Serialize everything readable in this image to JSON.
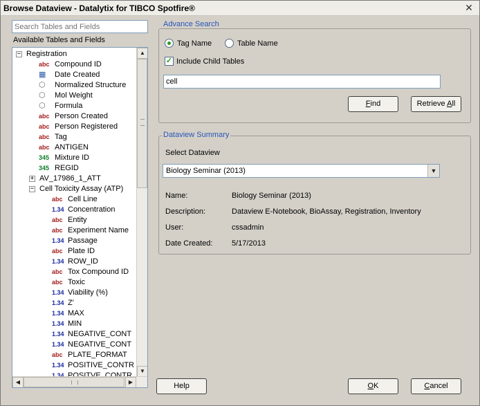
{
  "window": {
    "title": "Browse Dataview - Datalytix for TIBCO Spotfire®",
    "close_glyph": "✕"
  },
  "search": {
    "placeholder": "Search Tables and Fields",
    "value": ""
  },
  "available_label": "Available Tables and Fields",
  "tree": [
    {
      "level": 0,
      "expander": "−",
      "icon": "",
      "label": "Registration"
    },
    {
      "level": 1,
      "expander": "",
      "icon": "abc",
      "label": "Compound ID"
    },
    {
      "level": 1,
      "expander": "",
      "icon": "calendar",
      "label": "Date Created"
    },
    {
      "level": 1,
      "expander": "",
      "icon": "gear",
      "label": "Normalized Structure"
    },
    {
      "level": 1,
      "expander": "",
      "icon": "gear",
      "label": "Mol Weight"
    },
    {
      "level": 1,
      "expander": "",
      "icon": "gear",
      "label": "Formula"
    },
    {
      "level": 1,
      "expander": "",
      "icon": "abc",
      "label": "Person Created"
    },
    {
      "level": 1,
      "expander": "",
      "icon": "abc",
      "label": "Person Registered"
    },
    {
      "level": 1,
      "expander": "",
      "icon": "abc",
      "label": "Tag"
    },
    {
      "level": 1,
      "expander": "",
      "icon": "abc",
      "label": "ANTIGEN"
    },
    {
      "level": 1,
      "expander": "",
      "icon": "345",
      "label": "Mixture ID"
    },
    {
      "level": 1,
      "expander": "",
      "icon": "345",
      "label": "REGID"
    },
    {
      "level": 1,
      "expander": "+",
      "icon": "",
      "label": "AV_17986_1_ATT"
    },
    {
      "level": 1,
      "expander": "−",
      "icon": "",
      "label": "Cell Toxicity Assay (ATP)"
    },
    {
      "level": 2,
      "expander": "",
      "icon": "abc",
      "label": "Cell Line"
    },
    {
      "level": 2,
      "expander": "",
      "icon": "1.34",
      "label": "Concentration"
    },
    {
      "level": 2,
      "expander": "",
      "icon": "abc",
      "label": "Entity"
    },
    {
      "level": 2,
      "expander": "",
      "icon": "abc",
      "label": "Experiment Name"
    },
    {
      "level": 2,
      "expander": "",
      "icon": "1.34",
      "label": "Passage"
    },
    {
      "level": 2,
      "expander": "",
      "icon": "abc",
      "label": "Plate ID"
    },
    {
      "level": 2,
      "expander": "",
      "icon": "1.34",
      "label": "ROW_ID"
    },
    {
      "level": 2,
      "expander": "",
      "icon": "abc",
      "label": "Tox Compound ID"
    },
    {
      "level": 2,
      "expander": "",
      "icon": "abc",
      "label": "Toxic"
    },
    {
      "level": 2,
      "expander": "",
      "icon": "1.34",
      "label": "Viability (%)"
    },
    {
      "level": 2,
      "expander": "",
      "icon": "1.34",
      "label": "Z'"
    },
    {
      "level": 2,
      "expander": "",
      "icon": "1.34",
      "label": "MAX"
    },
    {
      "level": 2,
      "expander": "",
      "icon": "1.34",
      "label": "MIN"
    },
    {
      "level": 2,
      "expander": "",
      "icon": "1.34",
      "label": "NEGATIVE_CONT"
    },
    {
      "level": 2,
      "expander": "",
      "icon": "1.34",
      "label": "NEGATIVE_CONT"
    },
    {
      "level": 2,
      "expander": "",
      "icon": "abc",
      "label": "PLATE_FORMAT"
    },
    {
      "level": 2,
      "expander": "",
      "icon": "1.34",
      "label": "POSITIVE_CONTR"
    },
    {
      "level": 2,
      "expander": "",
      "icon": "1.34",
      "label": "POSITVE_CONTR"
    }
  ],
  "advance_search": {
    "legend": "Advance Search",
    "radio_tag_label": "Tag Name",
    "radio_table_label": "Table Name",
    "selected": "Tag Name",
    "include_child_label": "Include Child Tables",
    "include_child_checked": true,
    "query": "cell",
    "find_pre": "",
    "find_acc": "F",
    "find_post": "ind",
    "retrieve_pre": "Retrieve ",
    "retrieve_acc": "A",
    "retrieve_post": "ll"
  },
  "summary": {
    "legend": "Dataview Summary",
    "select_label": "Select Dataview",
    "selected_dataview": "Biology Seminar (2013)",
    "name_key": "Name:",
    "name_val": "Biology Seminar (2013)",
    "desc_key": "Description:",
    "desc_val": "Dataview E-Notebook, BioAssay, Registration, Inventory",
    "user_key": "User:",
    "user_val": "cssadmin",
    "date_key": "Date Created:",
    "date_val": "5/17/2013"
  },
  "buttons": {
    "help": "Help",
    "ok_acc": "O",
    "ok_post": "K",
    "cancel_acc": "C",
    "cancel_post": "ancel"
  },
  "colors": {
    "legend": "#2854b8",
    "checked": "#21a121",
    "abc": "#a31b1b",
    "num134": "#1b2a9e",
    "num345": "#0e7d2a"
  }
}
